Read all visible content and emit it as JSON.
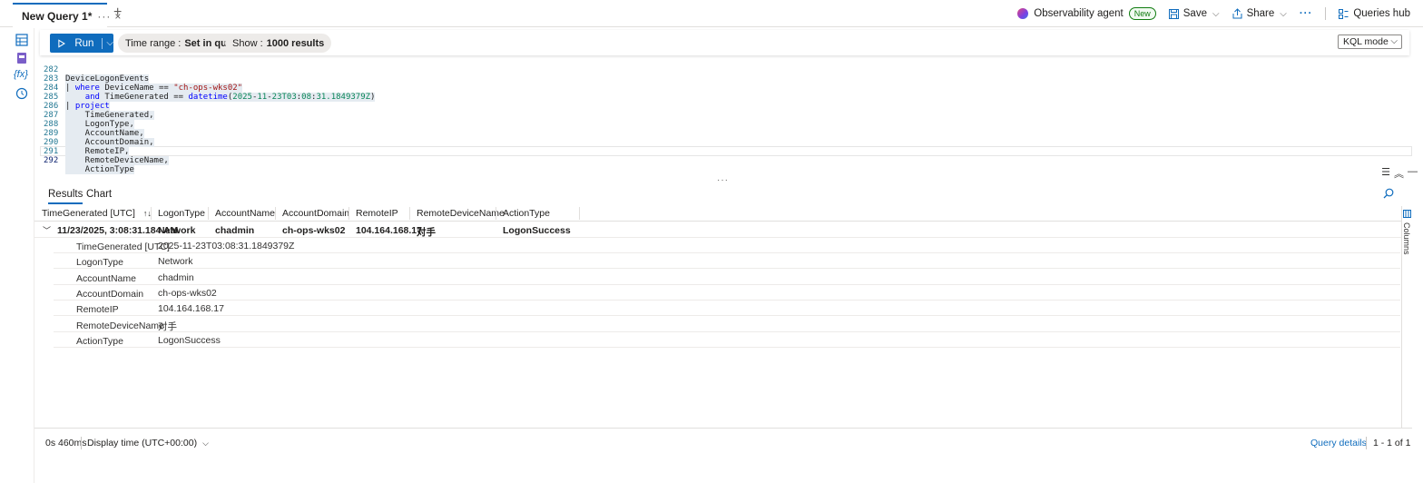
{
  "tab": {
    "title": "New Query 1*",
    "more": "···",
    "close": "×",
    "add": "+"
  },
  "header_actions": {
    "agent_label": "Observability agent",
    "agent_badge": "New",
    "save_label": "Save",
    "share_label": "Share",
    "more": "···",
    "queries_hub_label": "Queries hub"
  },
  "toolbar": {
    "run_label": "Run",
    "time_range_label": "Time range :",
    "time_range_value": "Set in query",
    "show_label": "Show :",
    "show_value": "1000 results",
    "mode_value": "KQL mode"
  },
  "left_rail": {
    "icons": [
      "tables-icon",
      "queries-icon",
      "functions-icon",
      "history-icon"
    ],
    "functions_glyph": "{fx}"
  },
  "editor": {
    "lines": [
      {
        "num": "282"
      },
      {
        "num": "283"
      },
      {
        "num": "284"
      },
      {
        "num": "285"
      },
      {
        "num": "286"
      },
      {
        "num": "287"
      },
      {
        "num": "288"
      },
      {
        "num": "289"
      },
      {
        "num": "290"
      },
      {
        "num": "291"
      },
      {
        "num": "292"
      }
    ],
    "tokens": {
      "l282": "DeviceLogonEvents",
      "l283_pipe": "| ",
      "l283_kw": "where",
      "l283_mid": " DeviceName == ",
      "l283_str": "\"ch-ops-wks02\"",
      "l284_indent": "    ",
      "l284_kw1": "and",
      "l284_mid": " TimeGenerated == ",
      "l284_kw2": "datetime",
      "l284_open": "(",
      "l284_d1": "2025",
      "l284_dash1": "-",
      "l284_d2": "11",
      "l284_dash2": "-",
      "l284_d3": "23T03",
      "l284_c1": ":",
      "l284_d4": "08",
      "l284_c2": ":",
      "l284_d5": "31.1849379Z",
      "l284_close": ")",
      "l285_pipe": "| ",
      "l285_kw": "project",
      "l286": "    TimeGenerated,",
      "l287": "    LogonType,",
      "l288": "    AccountName,",
      "l289": "    AccountDomain,",
      "l290": "    RemoteIP,",
      "l291": "    RemoteDeviceName,",
      "l292": "    ActionType"
    },
    "splitter": "···"
  },
  "results": {
    "tabs": [
      "Results",
      "Chart"
    ],
    "columns": [
      "TimeGenerated [UTC]",
      "LogonType",
      "AccountName",
      "AccountDomain",
      "RemoteIP",
      "RemoteDeviceName",
      "ActionType"
    ],
    "sort_indicator": "↑↓",
    "row": {
      "TimeGenerated": "11/23/2025, 3:08:31.184 AM",
      "LogonType": "Network",
      "AccountName": "chadmin",
      "AccountDomain": "ch-ops-wks02",
      "RemoteIP": "104.164.168.17",
      "RemoteDeviceName": "对手",
      "ActionType": "LogonSuccess"
    },
    "details": [
      {
        "key": "TimeGenerated [UTC]",
        "value": "2025-11-23T03:08:31.1849379Z"
      },
      {
        "key": "LogonType",
        "value": "Network"
      },
      {
        "key": "AccountName",
        "value": "chadmin"
      },
      {
        "key": "AccountDomain",
        "value": "ch-ops-wks02"
      },
      {
        "key": "RemoteIP",
        "value": "104.164.168.17"
      },
      {
        "key": "RemoteDeviceName",
        "value": "对手"
      },
      {
        "key": "ActionType",
        "value": "LogonSuccess"
      }
    ],
    "columns_panel_label": "Columns"
  },
  "status": {
    "elapsed": "0s 460ms",
    "display_time": "Display time (UTC+00:00)",
    "query_details": "Query details",
    "count": "1 - 1 of 1"
  },
  "colors": {
    "accent": "#0f6cbd",
    "keyword": "#0000ff",
    "string": "#a31515",
    "number": "#098658"
  }
}
